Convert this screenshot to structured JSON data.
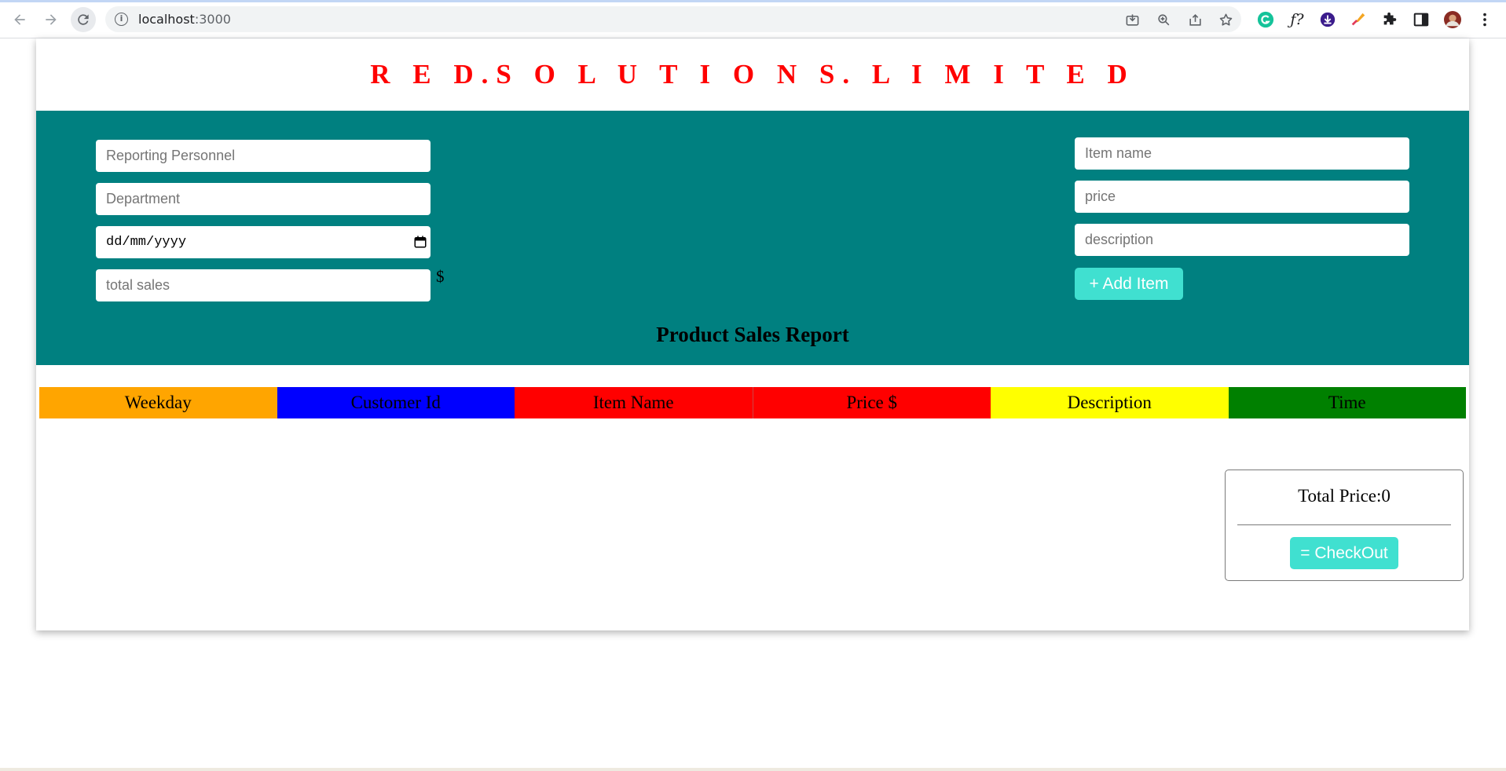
{
  "browser": {
    "url_host": "localhost",
    "url_port": ":3000",
    "icons": {
      "back": "arrow-left-icon",
      "forward": "arrow-right-icon",
      "reload": "reload-icon",
      "site_info": "info-icon",
      "install": "install-icon",
      "zoom": "zoom-icon",
      "share": "share-icon",
      "bookmark": "star-icon",
      "grammarly": "grammarly-icon",
      "fx": "fx-icon",
      "download": "download-icon",
      "eyedropper": "eyedropper-icon",
      "extensions": "puzzle-icon",
      "sidepanel": "side-panel-icon",
      "menu": "kebab-menu-icon"
    },
    "fx_label": "ƒ?"
  },
  "header": {
    "brand": "R E D.S O L U T I O N S. L I M I T E D"
  },
  "left_form": {
    "personnel_placeholder": "Reporting Personnel",
    "department_placeholder": "Department",
    "date_placeholder": "dd/mm/yyyy",
    "total_sales_placeholder": "total sales",
    "currency": "$"
  },
  "right_form": {
    "item_name_placeholder": "Item name",
    "price_placeholder": "price",
    "description_placeholder": "description",
    "add_button": "+ Add Item"
  },
  "report": {
    "title": "Product Sales Report",
    "columns": [
      {
        "label": "Weekday",
        "color": "#ffa500"
      },
      {
        "label": "Customer Id",
        "color": "#0000ff"
      },
      {
        "label": "Item Name",
        "color": "#ff0000"
      },
      {
        "label": "Price $",
        "color": "#ff0000"
      },
      {
        "label": "Description",
        "color": "#ffff00"
      },
      {
        "label": "Time",
        "color": "#008000"
      }
    ]
  },
  "summary": {
    "total_label": "Total Price:0",
    "checkout_button": "= CheckOut"
  },
  "colors": {
    "brand": "#ff0000",
    "panel": "#008080",
    "button": "#40e0d0"
  }
}
